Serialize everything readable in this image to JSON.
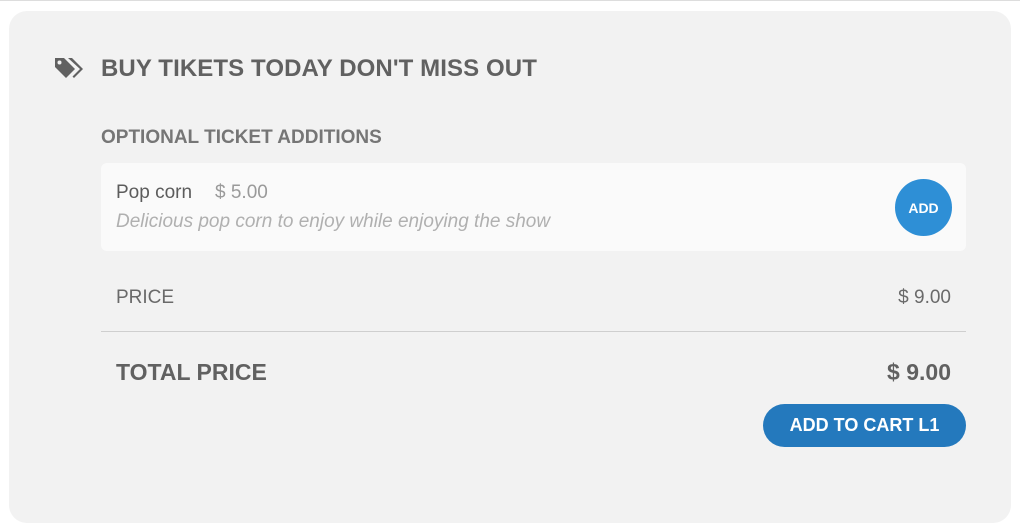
{
  "header": {
    "icon": "tags-icon",
    "title": "BUY TIKETS TODAY DON'T MISS OUT"
  },
  "additions": {
    "section_title": "OPTIONAL TICKET ADDITIONS",
    "items": [
      {
        "name": "Pop corn",
        "price": "$ 5.00",
        "description": "Delicious pop corn to enjoy while enjoying the show",
        "button_label": "ADD"
      }
    ]
  },
  "summary": {
    "price_label": "PRICE",
    "price_value": "$ 9.00",
    "total_label": "TOTAL PRICE",
    "total_value": "$ 9.00"
  },
  "actions": {
    "add_to_cart_label": "ADD TO CART L1"
  },
  "colors": {
    "card_background": "#f2f2f2",
    "primary_button": "#2479bd",
    "add_button": "#2e8fd6"
  }
}
